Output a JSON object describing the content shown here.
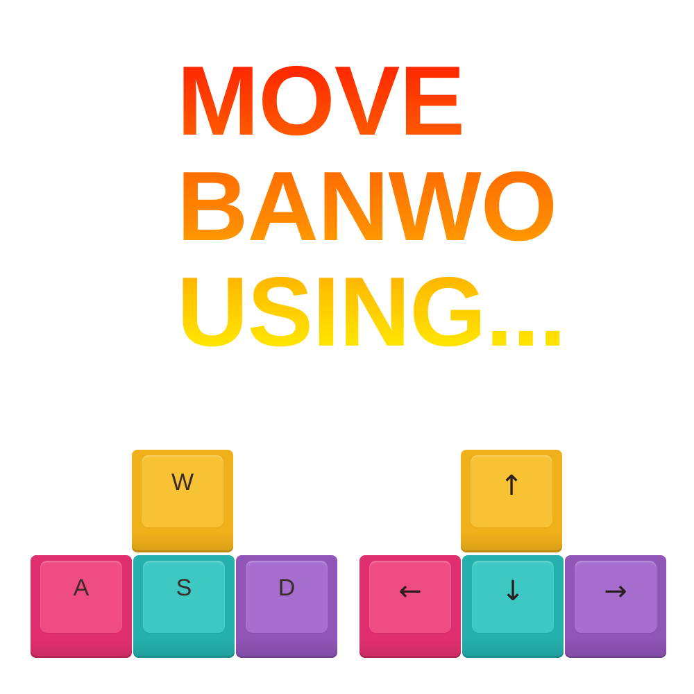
{
  "headline": {
    "lines": [
      "MOVE",
      "BANWO",
      "USING..."
    ]
  },
  "keypads": {
    "wasd": {
      "up": "W",
      "left": "A",
      "down": "S",
      "right": "D"
    },
    "arrows": {
      "up": "↑",
      "left": "←",
      "down": "↓",
      "right": "→"
    }
  },
  "colors": {
    "headline_top": "#ff1a00",
    "headline_bottom": "#fff200",
    "key_up": "#f7c233",
    "key_left": "#ee4c83",
    "key_down": "#3dc8c3",
    "key_right": "#a66fcf"
  }
}
